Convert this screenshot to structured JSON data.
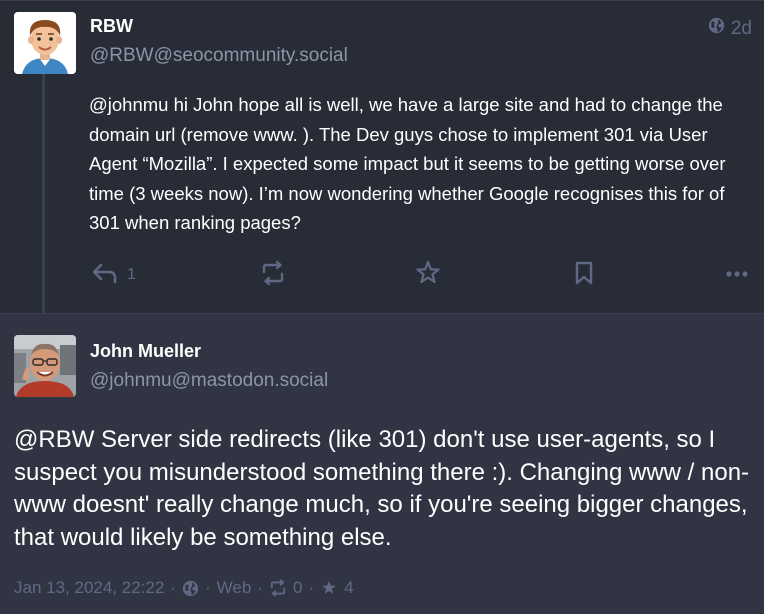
{
  "post1": {
    "display_name": "RBW",
    "handle": "@RBW@seocommunity.social",
    "relative_time": "2d",
    "visibility_icon": "globe-icon",
    "content": "@johnmu hi John hope all is well, we have a large site and had to change the domain url (remove www. ). The Dev guys chose to implement 301 via User Agent “Mozilla”. I expected some impact but it seems to be getting worse over time (3 weeks now). I’m now wondering whether Google recognises this for of 301 when ranking pages?",
    "reply_count": "1",
    "actions": [
      "reply-icon",
      "boost-icon",
      "star-icon",
      "bookmark-icon",
      "more-icon"
    ]
  },
  "post2": {
    "display_name": "John Mueller",
    "handle": "@johnmu@mastodon.social",
    "content": "@RBW Server side redirects (like 301) don't use user-agents, so I suspect you misunderstood something there :). Changing www / non-www doesnt' really change much, so if you're seeing bigger changes, that would likely be something else.",
    "timestamp": "Jan 13, 2024, 22:22",
    "visibility_icon": "globe-icon",
    "application": "Web",
    "boost_count": "0",
    "favourite_count": "4",
    "separator": "·"
  },
  "colors": {
    "background": "#282c37",
    "focused_background": "#313543",
    "muted": "#606984",
    "handle": "#8e94a8",
    "border": "#393f4f"
  }
}
